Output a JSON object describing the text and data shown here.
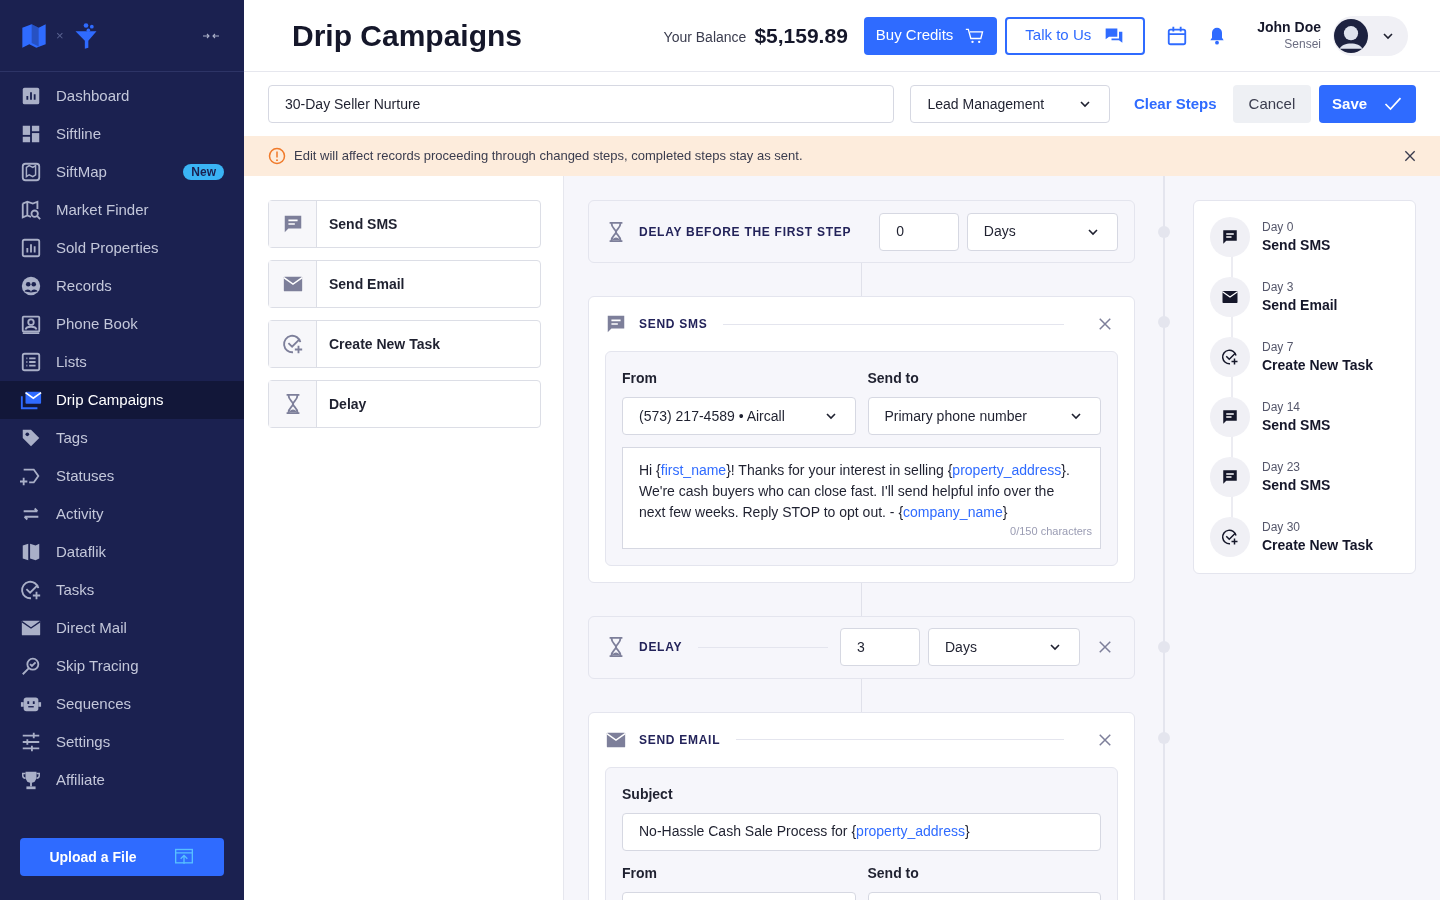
{
  "sidebar": {
    "items": [
      {
        "label": "Dashboard",
        "selected": false
      },
      {
        "label": "Siftline",
        "selected": false
      },
      {
        "label": "SiftMap",
        "selected": false,
        "badge": "New"
      },
      {
        "label": "Market Finder",
        "selected": false
      },
      {
        "label": "Sold Properties",
        "selected": false
      },
      {
        "label": "Records",
        "selected": false
      },
      {
        "label": "Phone Book",
        "selected": false
      },
      {
        "label": "Lists",
        "selected": false
      },
      {
        "label": "Drip Campaigns",
        "selected": true
      },
      {
        "label": "Tags",
        "selected": false
      },
      {
        "label": "Statuses",
        "selected": false
      },
      {
        "label": "Activity",
        "selected": false
      },
      {
        "label": "Dataflik",
        "selected": false
      },
      {
        "label": "Tasks",
        "selected": false
      },
      {
        "label": "Direct Mail",
        "selected": false
      },
      {
        "label": "Skip Tracing",
        "selected": false
      },
      {
        "label": "Sequences",
        "selected": false
      },
      {
        "label": "Settings",
        "selected": false
      },
      {
        "label": "Affiliate",
        "selected": false
      }
    ],
    "logo_separator": "×",
    "upload_button": "Upload a File"
  },
  "header": {
    "title": "Drip Campaigns",
    "balance_label": "Your Balance",
    "balance": "$5,159.89",
    "buy_button": "Buy Credits",
    "talk_button": "Talk to Us",
    "user": {
      "name": "John Doe",
      "role": "Sensei"
    }
  },
  "campaign": {
    "name": "30-Day Seller Nurture",
    "category": "Lead Management",
    "clear_button": "Clear Steps",
    "cancel_button": "Cancel",
    "save_button": "Save"
  },
  "alert": {
    "message": "Edit will affect records proceeding through changed steps, completed steps stay as sent."
  },
  "palette": [
    {
      "kind": "sms",
      "label": "Send SMS"
    },
    {
      "kind": "email",
      "label": "Send Email"
    },
    {
      "kind": "task",
      "label": "Create New Task"
    },
    {
      "kind": "delay",
      "label": "Delay"
    }
  ],
  "first_delay": {
    "title": "DELAY BEFORE THE FIRST STEP",
    "value": "0",
    "unit": "Days"
  },
  "steps": [
    {
      "kind": "sms",
      "title": "SEND SMS",
      "from_label": "From",
      "from": "(573) 217-4589 • Aircall",
      "to_label": "Send to",
      "to": "Primary phone number",
      "message": [
        {
          "kind": "text",
          "text": "Hi {"
        },
        {
          "kind": "variable",
          "text": "first_name"
        },
        {
          "kind": "text",
          "text": "}! Thanks for your interest in selling {"
        },
        {
          "kind": "variable",
          "text": "property_address"
        },
        {
          "kind": "text",
          "text": "}. We're cash buyers who can close fast. I'll send helpful info over the next few weeks. Reply STOP to opt out. - {"
        },
        {
          "kind": "variable",
          "text": "company_name"
        },
        {
          "kind": "text",
          "text": "}"
        }
      ],
      "counter": "0/150 characters"
    },
    {
      "kind": "delay",
      "title": "DELAY",
      "value": "3",
      "unit": "Days"
    },
    {
      "kind": "email",
      "title": "SEND EMAIL",
      "subject_label": "Subject",
      "subject": [
        {
          "kind": "text",
          "text": "No-Hassle Cash Sale Process for {"
        },
        {
          "kind": "variable",
          "text": "property_address"
        },
        {
          "kind": "text",
          "text": "}"
        }
      ],
      "from_label": "From",
      "to_label": "Send to"
    }
  ],
  "timeline": [
    {
      "kind": "sms",
      "day": "Day 0",
      "label": "Send SMS"
    },
    {
      "kind": "email",
      "day": "Day 3",
      "label": "Send Email"
    },
    {
      "kind": "task",
      "day": "Day 7",
      "label": "Create New Task"
    },
    {
      "kind": "sms",
      "day": "Day 14",
      "label": "Send SMS"
    },
    {
      "kind": "sms",
      "day": "Day 23",
      "label": "Send SMS"
    },
    {
      "kind": "task",
      "day": "Day 30",
      "label": "Create New Task"
    }
  ]
}
